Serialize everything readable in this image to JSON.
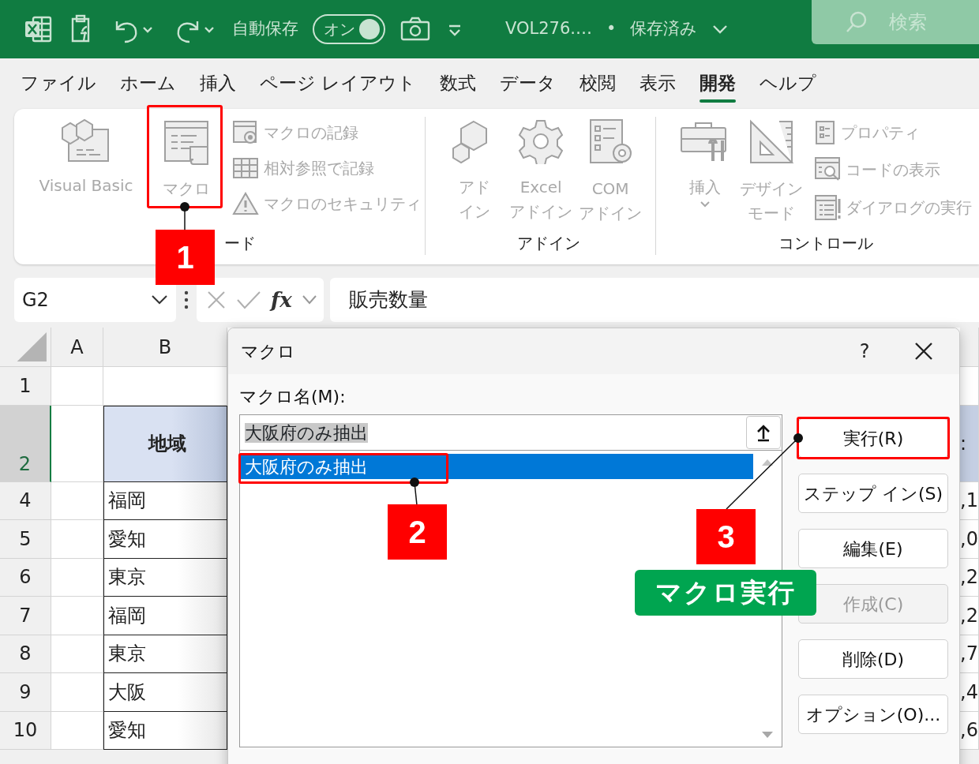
{
  "title_bar": {
    "autosave_label": "自動保存",
    "autosave_toggle": {
      "label": "オン",
      "on": true
    },
    "file_name": "VOL276.…",
    "separator": "•",
    "save_status": "保存済み",
    "search": {
      "placeholder": "検索"
    }
  },
  "ribbon_tabs": [
    {
      "label": "ファイル",
      "selected": false
    },
    {
      "label": "ホーム",
      "selected": false
    },
    {
      "label": "挿入",
      "selected": false
    },
    {
      "label": "ページ レイアウト",
      "selected": false
    },
    {
      "label": "数式",
      "selected": false
    },
    {
      "label": "データ",
      "selected": false
    },
    {
      "label": "校閲",
      "selected": false
    },
    {
      "label": "表示",
      "selected": false
    },
    {
      "label": "開発",
      "selected": true
    },
    {
      "label": "ヘルプ",
      "selected": false
    }
  ],
  "ribbon_groups": [
    {
      "label": "ード",
      "large_buttons": [
        {
          "kind": "visualbasic",
          "lines": [
            "Visual Basic"
          ],
          "disabled": true
        },
        {
          "kind": "macro",
          "lines": [
            "マクロ"
          ],
          "disabled": true
        }
      ],
      "small_buttons": [
        {
          "kind": "record",
          "label": "マクロの記録",
          "disabled": true
        },
        {
          "kind": "relative",
          "label": "相対参照で記録",
          "disabled": true
        },
        {
          "kind": "security",
          "label": "マクロのセキュリティ",
          "disabled": true
        }
      ]
    },
    {
      "label": "アドイン",
      "large_buttons": [
        {
          "kind": "addin",
          "lines": [
            "アド",
            "イン"
          ],
          "disabled": true
        },
        {
          "kind": "gear",
          "lines": [
            "Excel",
            "アドイン"
          ],
          "disabled": true
        },
        {
          "kind": "comaddin",
          "lines": [
            "COM",
            "アドイン"
          ],
          "disabled": true
        }
      ]
    },
    {
      "label": "コントロール",
      "large_buttons": [
        {
          "kind": "toolbox",
          "lines": [
            "挿入"
          ],
          "dropdown": true,
          "disabled": true
        },
        {
          "kind": "design",
          "lines": [
            "デザイン",
            "モード"
          ],
          "disabled": true
        }
      ],
      "small_buttons": [
        {
          "kind": "properties",
          "label": "プロパティ",
          "disabled": true
        },
        {
          "kind": "viewcode",
          "label": "コードの表示",
          "disabled": true
        },
        {
          "kind": "dialog",
          "label": "ダイアログの実行",
          "disabled": true
        }
      ]
    }
  ],
  "formula_bar": {
    "name_box": "G2",
    "fx_label": "fx",
    "formula": "販売数量"
  },
  "sheet": {
    "columns": [
      "A",
      "B"
    ],
    "rows": [
      {
        "number": "1",
        "selected": false
      },
      {
        "number": "2",
        "selected": true,
        "kind": "header",
        "cell_b": "地域",
        "cell_cut": ":"
      },
      {
        "number": "4",
        "selected": false,
        "kind": "data",
        "cell_b": "福岡",
        "cell_cut": ",1"
      },
      {
        "number": "5",
        "selected": false,
        "kind": "data",
        "cell_b": "愛知",
        "cell_cut": ",0"
      },
      {
        "number": "6",
        "selected": false,
        "kind": "data",
        "cell_b": "東京",
        "cell_cut": ",2"
      },
      {
        "number": "7",
        "selected": false,
        "kind": "data",
        "cell_b": "福岡",
        "cell_cut": ",2"
      },
      {
        "number": "8",
        "selected": false,
        "kind": "data",
        "cell_b": "東京",
        "cell_cut": ",7"
      },
      {
        "number": "9",
        "selected": false,
        "kind": "data",
        "cell_b": "大阪",
        "cell_cut": ",4"
      },
      {
        "number": "10",
        "selected": false,
        "kind": "data",
        "cell_b": "愛知",
        "cell_cut": ",6"
      }
    ]
  },
  "dialog": {
    "title": "マクロ",
    "help": "?",
    "name_label": "マクロ名(M):",
    "name_value": "大阪府のみ抽出",
    "macros": [
      {
        "label": "大阪府のみ抽出",
        "selected": true
      }
    ],
    "buttons": [
      {
        "label": "実行(R)",
        "disabled": false
      },
      {
        "label": "ステップ イン(S)",
        "disabled": false
      },
      {
        "label": "編集(E)",
        "disabled": false
      },
      {
        "label": "作成(C)",
        "disabled": true
      },
      {
        "label": "削除(D)",
        "disabled": false
      },
      {
        "label": "オプション(O)...",
        "disabled": false
      }
    ]
  },
  "callouts": [
    {
      "number": "1"
    },
    {
      "number": "2"
    },
    {
      "number": "3"
    }
  ],
  "caption": "マクロ実行"
}
